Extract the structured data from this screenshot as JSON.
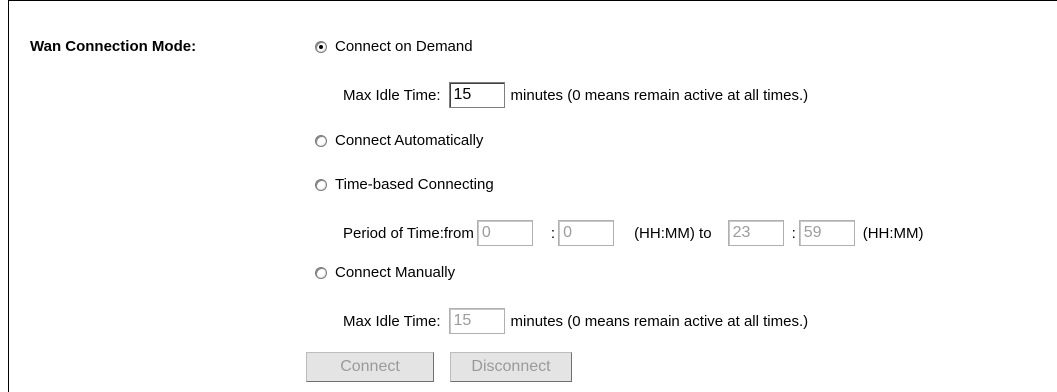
{
  "wan": {
    "label": "Wan Connection Mode:",
    "options": [
      {
        "label": "Connect on Demand",
        "selected": true
      },
      {
        "label": "Connect Automatically",
        "selected": false
      },
      {
        "label": "Time-based Connecting",
        "selected": false
      },
      {
        "label": "Connect Manually",
        "selected": false
      }
    ],
    "demand_idle": {
      "label": "Max Idle Time:",
      "value": "15",
      "suffix": "minutes (0 means remain active at all times.)"
    },
    "period": {
      "label": "Period of Time:from",
      "from_hh": "0",
      "from_mm": "0",
      "colon": ":",
      "hhmm_to": "(HH:MM) to",
      "to_hh": "23",
      "to_mm": "59",
      "hhmm_end": "(HH:MM)"
    },
    "manual_idle": {
      "label": "Max Idle Time:",
      "value": "15",
      "suffix": "minutes (0 means remain active at all times.)"
    },
    "buttons": {
      "connect": "Connect",
      "disconnect": "Disconnect"
    }
  }
}
